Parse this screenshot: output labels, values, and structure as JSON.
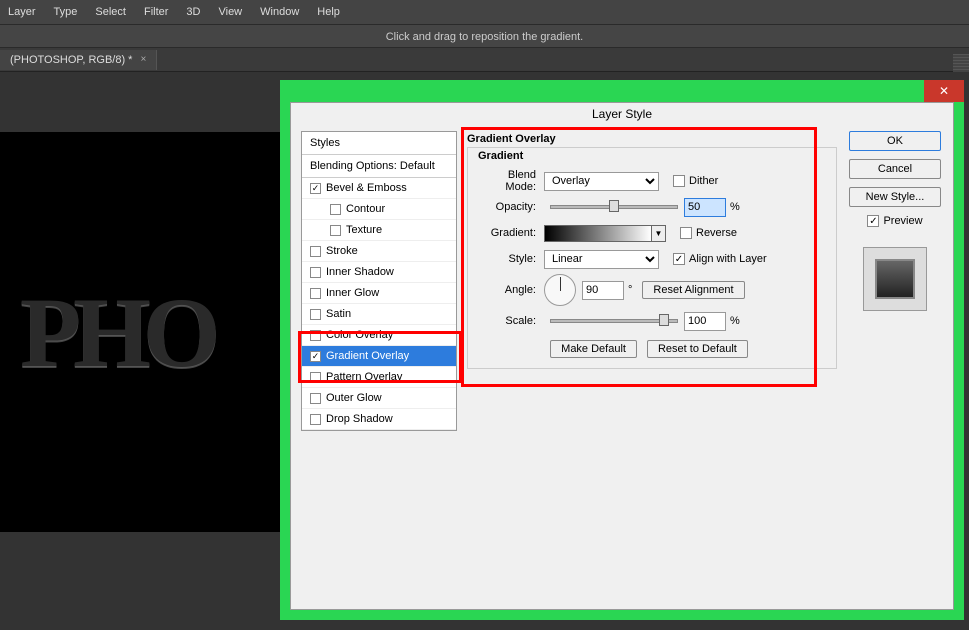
{
  "menu": [
    "Layer",
    "Type",
    "Select",
    "Filter",
    "3D",
    "View",
    "Window",
    "Help"
  ],
  "hint": "Click and drag to reposition the gradient.",
  "tab": {
    "name": "(PHOTOSHOP, RGB/8) *",
    "close": "×"
  },
  "canvas_text": "PHO",
  "dialog": {
    "title": "Layer Style",
    "close": "✕",
    "styles_header": "Styles",
    "blending": "Blending Options: Default",
    "items": [
      {
        "label": "Bevel & Emboss",
        "checked": true,
        "sub": false
      },
      {
        "label": "Contour",
        "checked": false,
        "sub": true
      },
      {
        "label": "Texture",
        "checked": false,
        "sub": true
      },
      {
        "label": "Stroke",
        "checked": false,
        "sub": false
      },
      {
        "label": "Inner Shadow",
        "checked": false,
        "sub": false
      },
      {
        "label": "Inner Glow",
        "checked": false,
        "sub": false
      },
      {
        "label": "Satin",
        "checked": false,
        "sub": false
      },
      {
        "label": "Color Overlay",
        "checked": false,
        "sub": false
      },
      {
        "label": "Gradient Overlay",
        "checked": true,
        "sub": false,
        "selected": true
      },
      {
        "label": "Pattern Overlay",
        "checked": false,
        "sub": false
      },
      {
        "label": "Outer Glow",
        "checked": false,
        "sub": false
      },
      {
        "label": "Drop Shadow",
        "checked": false,
        "sub": false
      }
    ],
    "group_title": "Gradient Overlay",
    "group_sub": "Gradient",
    "blend_mode": {
      "label": "Blend Mode:",
      "value": "Overlay"
    },
    "dither": "Dither",
    "opacity": {
      "label": "Opacity:",
      "value": "50",
      "pct": "%"
    },
    "gradient_label": "Gradient:",
    "reverse": "Reverse",
    "style": {
      "label": "Style:",
      "value": "Linear"
    },
    "align": "Align with Layer",
    "angle": {
      "label": "Angle:",
      "value": "90",
      "deg": "°"
    },
    "reset_align": "Reset Alignment",
    "scale": {
      "label": "Scale:",
      "value": "100",
      "pct": "%"
    },
    "make_default": "Make Default",
    "reset_default": "Reset to Default",
    "ok": "OK",
    "cancel": "Cancel",
    "new_style": "New Style...",
    "preview": "Preview"
  }
}
